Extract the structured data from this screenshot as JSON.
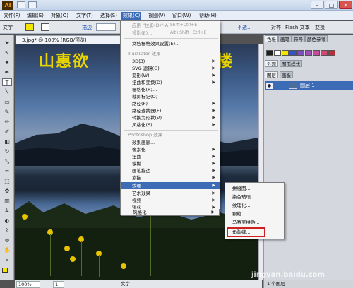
{
  "titlebar": {
    "logo": "Ai",
    "min": "–",
    "max": "□",
    "close": "✕"
  },
  "menubar": {
    "items": [
      "文件(F)",
      "编辑(E)",
      "对象(O)",
      "文字(T)",
      "选择(S)",
      "效果(C)",
      "视图(V)",
      "窗口(W)",
      "帮助(H)"
    ]
  },
  "controlbar": {
    "tool_label": "文字",
    "stroke_label": "描边",
    "opacity_link": "不透...",
    "align_label": "对齐",
    "flash_text": "Flash 文本",
    "transform": "变换"
  },
  "document": {
    "tab_title": "3.jpg* @ 100% (RGB/预览)",
    "logo_text": "山惠欲",
    "logo_text_right": "楼",
    "zoom": "100%",
    "page": "1",
    "status_text": "文字"
  },
  "panels": {
    "tab_top_1": "色板",
    "tab_top_2": "画笔",
    "tab_top_3": "符号",
    "tab_color_ref": "颜色参考",
    "tab_appearance": "外观",
    "tab_graphic_styles": "图形样式",
    "tab_layers": "图层",
    "tab_artboards": "画板",
    "layer_name": "图层 1",
    "layer_count": "1 个图层",
    "swatch_colors": [
      "#1f1f1f",
      "#ffffff",
      "#f2e600",
      "#3552c7",
      "#7b4fc0",
      "#a34fb8",
      "#c84a9e",
      "#d24873",
      "#b5303a",
      "#444444"
    ]
  },
  "effect_menu": {
    "apply_last": "应用 \"拉影(D)\"(A)",
    "apply_last_shortcut": "Shift+Ctrl+E",
    "last_effect": "投影(E)...",
    "last_effect_shortcut": "Alt+Shift+Ctrl+E",
    "doc_raster_settings": "文档栅格效果设置(E)...",
    "illustrator_header": "Illustrator 效果",
    "illustrator_items": [
      "3D(3)",
      "SVG 滤镜(G)",
      "变形(W)",
      "扭曲和变换(D)",
      "栅格化(R)...",
      "裁剪标记(O)",
      "路径(P)",
      "路径查找器(F)",
      "转换为形状(V)",
      "风格化(S)"
    ],
    "photoshop_header": "Photoshop 效果",
    "photoshop_items": [
      "效果画廊...",
      "像素化",
      "扭曲",
      "模糊",
      "画笔描边",
      "素描",
      "纹理",
      "艺术效果",
      "视频",
      "锐化",
      "风格化"
    ]
  },
  "texture_menu": {
    "items": [
      "拼缀图...",
      "染色玻璃...",
      "纹理化...",
      "颗粒...",
      "马赛克拼贴...",
      "龟裂缝..."
    ]
  },
  "watermark": "jingyan.baidu.com"
}
